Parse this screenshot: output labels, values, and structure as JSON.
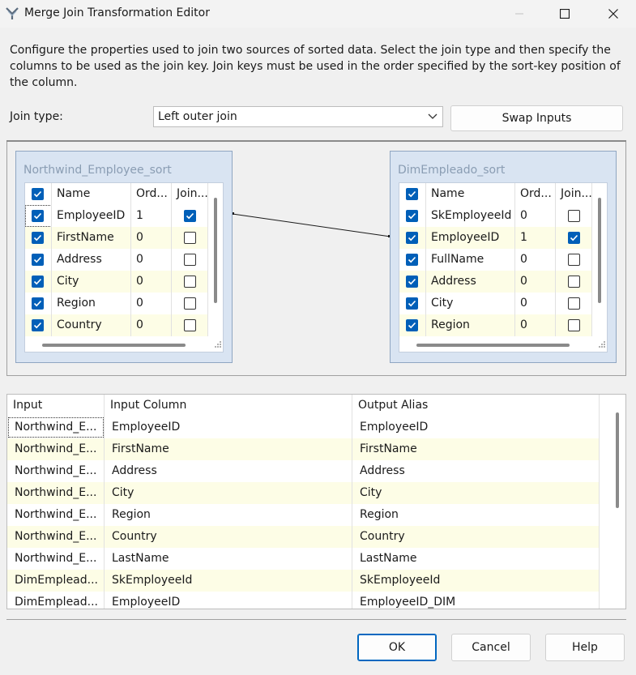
{
  "window": {
    "title": "Merge Join Transformation Editor"
  },
  "description": "Configure the properties used to join two sources of sorted data. Select the join type and then specify the columns to be used as the join key. Join keys must be used in the order specified by the sort-key position of the column.",
  "join_type": {
    "label": "Join type:",
    "value": "Left outer join"
  },
  "swap_inputs_label": "Swap Inputs",
  "left_input": {
    "title": "Northwind_Employee_sort",
    "headers": [
      "Name",
      "Ord...",
      "Join..."
    ],
    "rows": [
      {
        "name": "EmployeeID",
        "order": "1",
        "join": true
      },
      {
        "name": "FirstName",
        "order": "0",
        "join": false
      },
      {
        "name": "Address",
        "order": "0",
        "join": false
      },
      {
        "name": "City",
        "order": "0",
        "join": false
      },
      {
        "name": "Region",
        "order": "0",
        "join": false
      },
      {
        "name": "Country",
        "order": "0",
        "join": false
      }
    ]
  },
  "right_input": {
    "title": "DimEmpleado_sort",
    "headers": [
      "Name",
      "Ord...",
      "Join..."
    ],
    "rows": [
      {
        "name": "SkEmployeeId",
        "order": "0",
        "join": false
      },
      {
        "name": "EmployeeID",
        "order": "1",
        "join": true
      },
      {
        "name": "FullName",
        "order": "0",
        "join": false
      },
      {
        "name": "Address",
        "order": "0",
        "join": false
      },
      {
        "name": "City",
        "order": "0",
        "join": false
      },
      {
        "name": "Region",
        "order": "0",
        "join": false
      }
    ]
  },
  "output": {
    "headers": [
      "Input",
      "Input Column",
      "Output Alias"
    ],
    "rows": [
      [
        "Northwind_E...",
        "EmployeeID",
        "EmployeeID"
      ],
      [
        "Northwind_E...",
        "FirstName",
        "FirstName"
      ],
      [
        "Northwind_E...",
        "Address",
        "Address"
      ],
      [
        "Northwind_E...",
        "City",
        "City"
      ],
      [
        "Northwind_E...",
        "Region",
        "Region"
      ],
      [
        "Northwind_E...",
        "Country",
        "Country"
      ],
      [
        "Northwind_E...",
        "LastName",
        "LastName"
      ],
      [
        "DimEmplead...",
        "SkEmployeeId",
        "SkEmployeeId"
      ],
      [
        "DimEmplead...",
        "EmployeeID",
        "EmployeeID_DIM"
      ]
    ]
  },
  "buttons": {
    "ok": "OK",
    "cancel": "Cancel",
    "help": "Help"
  },
  "colors": {
    "accent": "#005fb8",
    "alt_row": "#fdfde6",
    "input_box": "#d9e4f2"
  },
  "icons": [
    "merge-join-icon",
    "minimize-icon",
    "maximize-icon",
    "close-icon",
    "chevron-down-icon",
    "resize-grip-icon"
  ]
}
